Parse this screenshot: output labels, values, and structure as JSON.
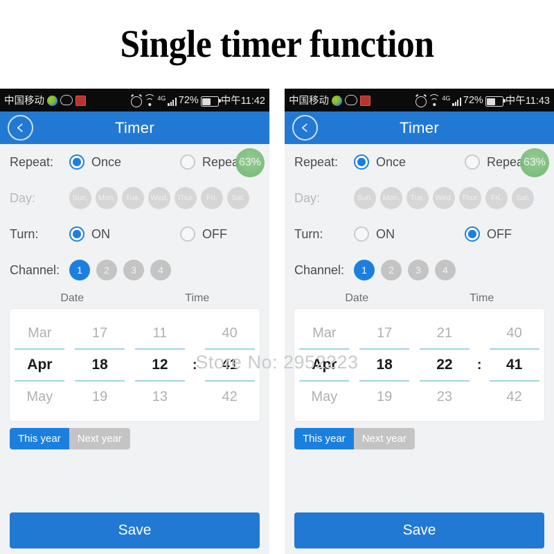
{
  "title": "Single timer function",
  "watermark": "Store No: 2952223",
  "phones": [
    {
      "id": "left",
      "statusbar": {
        "carrier": "中国移动",
        "icons_left": [
          "gallery-icon",
          "cloud-icon",
          "app-icon"
        ],
        "icons_right": [
          "alarm-icon",
          "wifi-icon",
          "signal-icon"
        ],
        "network": "4G",
        "battery_percent": "72%",
        "clock": "中午11:42"
      },
      "appbar": {
        "back_icon": "chevron-left-icon",
        "title": "Timer"
      },
      "badge": "63%",
      "repeat": {
        "label": "Repeat:",
        "options": [
          {
            "label": "Once",
            "selected": true
          },
          {
            "label": "Repeat",
            "selected": false
          }
        ]
      },
      "day": {
        "label": "Day:",
        "chips": [
          "Sun.",
          "Mon.",
          "Tue.",
          "Wed.",
          "Thur.",
          "Fri.",
          "Sat."
        ]
      },
      "turn": {
        "label": "Turn:",
        "options": [
          {
            "label": "ON",
            "selected": true
          },
          {
            "label": "OFF",
            "selected": false
          }
        ]
      },
      "channel": {
        "label": "Channel:",
        "items": [
          {
            "label": "1",
            "active": true
          },
          {
            "label": "2",
            "active": false
          },
          {
            "label": "3",
            "active": false
          },
          {
            "label": "4",
            "active": false
          }
        ]
      },
      "picker": {
        "head_date": "Date",
        "head_time": "Time",
        "colon": ":",
        "columns": [
          {
            "name": "month",
            "prev": "Mar",
            "selected": "Apr",
            "next": "May"
          },
          {
            "name": "day",
            "prev": "17",
            "selected": "18",
            "next": "19"
          },
          {
            "name": "hour",
            "prev": "11",
            "selected": "12",
            "next": "13"
          },
          {
            "name": "minute",
            "prev": "40",
            "selected": "41",
            "next": "42"
          }
        ]
      },
      "year_toggle": [
        {
          "label": "This year",
          "active": true
        },
        {
          "label": "Next year",
          "active": false
        }
      ],
      "save_label": "Save"
    },
    {
      "id": "right",
      "statusbar": {
        "carrier": "中国移动",
        "icons_left": [
          "gallery-icon",
          "cloud-icon",
          "app-icon"
        ],
        "icons_right": [
          "alarm-icon",
          "wifi-icon",
          "signal-icon"
        ],
        "network": "4G",
        "battery_percent": "72%",
        "clock": "中午11:43"
      },
      "appbar": {
        "back_icon": "chevron-left-icon",
        "title": "Timer"
      },
      "badge": "63%",
      "repeat": {
        "label": "Repeat:",
        "options": [
          {
            "label": "Once",
            "selected": true
          },
          {
            "label": "Repeat",
            "selected": false
          }
        ]
      },
      "day": {
        "label": "Day:",
        "chips": [
          "Sun.",
          "Mon.",
          "Tue.",
          "Wed.",
          "Thur.",
          "Fri.",
          "Sat."
        ]
      },
      "turn": {
        "label": "Turn:",
        "options": [
          {
            "label": "ON",
            "selected": false
          },
          {
            "label": "OFF",
            "selected": true
          }
        ]
      },
      "channel": {
        "label": "Channel:",
        "items": [
          {
            "label": "1",
            "active": true
          },
          {
            "label": "2",
            "active": false
          },
          {
            "label": "3",
            "active": false
          },
          {
            "label": "4",
            "active": false
          }
        ]
      },
      "picker": {
        "head_date": "Date",
        "head_time": "Time",
        "colon": ":",
        "columns": [
          {
            "name": "month",
            "prev": "Mar",
            "selected": "Apr",
            "next": "May"
          },
          {
            "name": "day",
            "prev": "17",
            "selected": "18",
            "next": "19"
          },
          {
            "name": "hour",
            "prev": "21",
            "selected": "22",
            "next": "23"
          },
          {
            "name": "minute",
            "prev": "40",
            "selected": "41",
            "next": "42"
          }
        ]
      },
      "year_toggle": [
        {
          "label": "This year",
          "active": true
        },
        {
          "label": "Next year",
          "active": false
        }
      ],
      "save_label": "Save"
    }
  ],
  "colors": {
    "accent_blue": "#2179d4",
    "radio_blue": "#1b7fe0",
    "chip_gray": "#c4c4c4",
    "badge_green": "#79bd79",
    "picker_line": "#9ed4e4",
    "screen_bg": "#f1f2f3"
  }
}
